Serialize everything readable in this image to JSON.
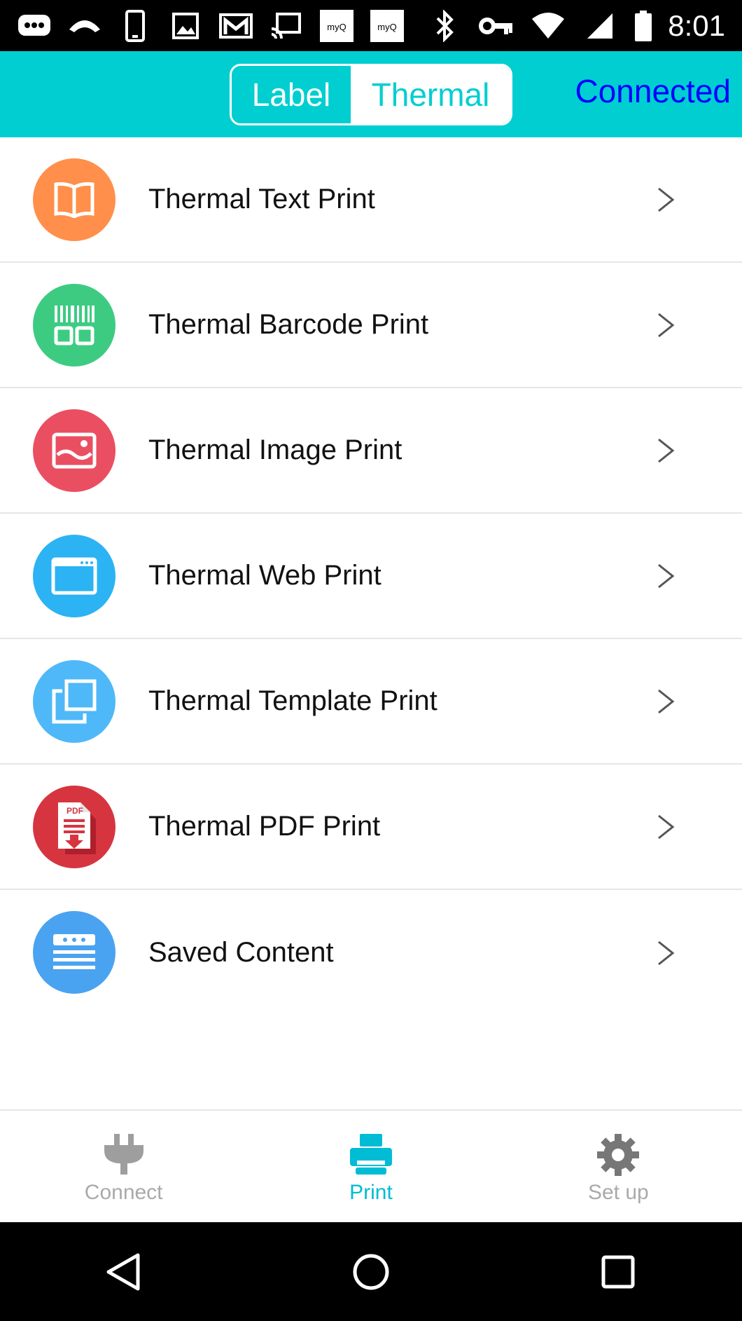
{
  "status_bar": {
    "time": "8:01",
    "icons_left": [
      "chat-bubble-icon",
      "voicemail-icon",
      "phone-device-icon",
      "image-icon",
      "gmail-icon",
      "cast-icon",
      "myq-icon",
      "myq-icon"
    ],
    "icons_right": [
      "bluetooth-icon",
      "vpn-key-icon",
      "wifi-icon",
      "signal-icon",
      "battery-icon"
    ]
  },
  "header": {
    "tabs": [
      {
        "label": "Label",
        "selected": false
      },
      {
        "label": "Thermal",
        "selected": true
      }
    ],
    "status": "Connected",
    "accent_color": "#00CED1",
    "status_color": "#0000FF"
  },
  "list": {
    "items": [
      {
        "label": "Thermal Text Print",
        "icon": "book-icon",
        "color": "#FF8F4A"
      },
      {
        "label": "Thermal Barcode Print",
        "icon": "barcode-icon",
        "color": "#3DCB82"
      },
      {
        "label": "Thermal Image Print",
        "icon": "image-icon",
        "color": "#EA4F61"
      },
      {
        "label": "Thermal Web Print",
        "icon": "browser-window-icon",
        "color": "#2BB3F4"
      },
      {
        "label": "Thermal Template Print",
        "icon": "template-copy-icon",
        "color": "#4FB8F8"
      },
      {
        "label": "Thermal PDF Print",
        "icon": "pdf-download-icon",
        "color": "#D63540"
      },
      {
        "label": "Saved Content",
        "icon": "saved-list-icon",
        "color": "#4AA3F0"
      }
    ]
  },
  "bottom_nav": {
    "items": [
      {
        "label": "Connect",
        "icon": "plug-icon",
        "active": false
      },
      {
        "label": "Print",
        "icon": "printer-icon",
        "active": true
      },
      {
        "label": "Set up",
        "icon": "gear-icon",
        "active": false
      }
    ]
  },
  "android_nav": [
    "back-icon",
    "home-icon",
    "recents-icon"
  ]
}
